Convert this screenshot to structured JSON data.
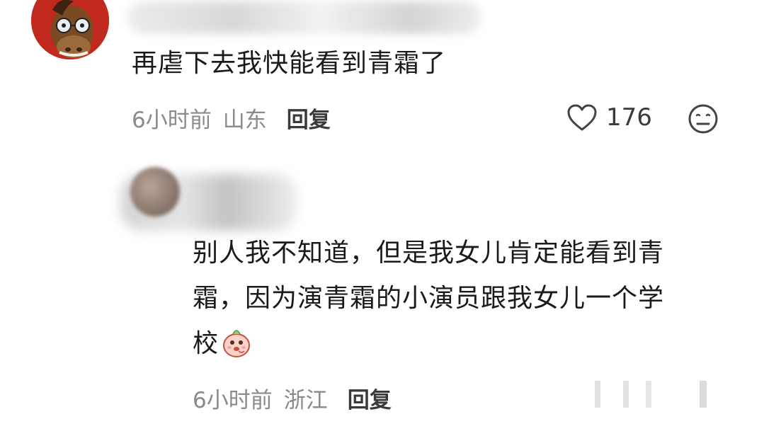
{
  "comments": [
    {
      "text": "再虐下去我快能看到青霜了",
      "time": "6小时前",
      "location": "山东",
      "reply_label": "回复",
      "likes": "176"
    },
    {
      "lines": [
        "别人我不知道，但是我女儿肯定能看到青",
        "霜，因为演青霜的小演员跟我女儿一个学",
        "校"
      ],
      "time": "6小时前",
      "location": "浙江",
      "reply_label": "回复"
    }
  ],
  "icons": {
    "like": "heart-outline-icon",
    "dislike": "neutral-face-icon",
    "emoji": "peach-emoji-icon"
  },
  "colors": {
    "text": "#1a1a1a",
    "meta": "#8a8a8a",
    "reply": "#3a3a3a",
    "avatar_bg": "#c2291e"
  }
}
